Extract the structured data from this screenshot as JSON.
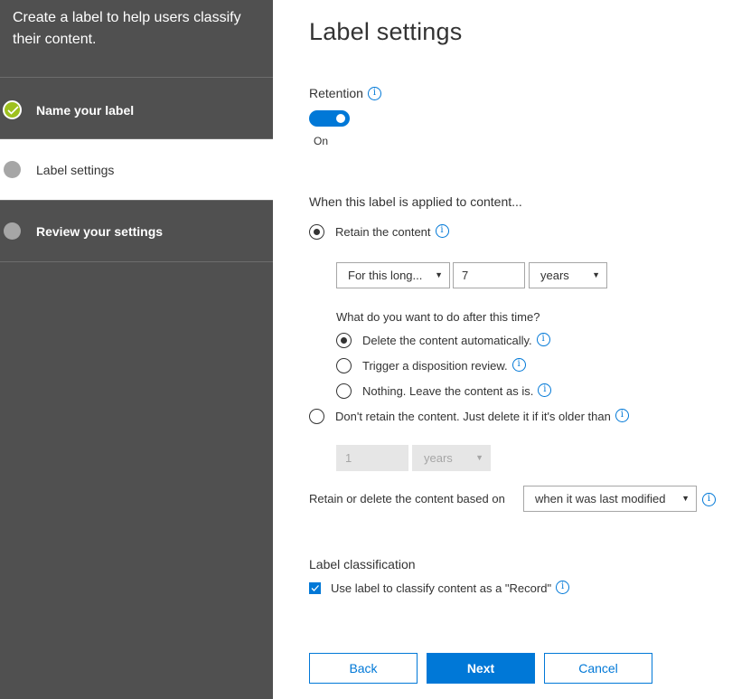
{
  "sidebar": {
    "intro": "Create a label to help users classify their content.",
    "steps": [
      {
        "label": "Name your label",
        "status": "completed"
      },
      {
        "label": "Label settings",
        "status": "current"
      },
      {
        "label": "Review your settings",
        "status": "pending"
      }
    ]
  },
  "main": {
    "title": "Label settings",
    "retention": {
      "title": "Retention",
      "info_icon": "i",
      "toggle_on": true,
      "toggle_state_label": "On"
    },
    "applied": {
      "title": "When this label is applied to content...",
      "retain_option": {
        "label": "Retain the content",
        "checked": true
      },
      "duration_select": "For this long...",
      "duration_value": "7",
      "duration_unit": "years",
      "after_question": "What do you want to do after this time?",
      "after_options": [
        {
          "label": "Delete the content automatically.",
          "checked": true
        },
        {
          "label": "Trigger a disposition review.",
          "checked": false
        },
        {
          "label": "Nothing. Leave the content as is.",
          "checked": false
        }
      ],
      "delete_option": {
        "label": "Don't retain the content. Just delete it if it's older than",
        "checked": false
      },
      "delete_value": "1",
      "delete_unit": "years",
      "basis_label": "Retain or delete the content based on",
      "basis_select": "when it was last modified"
    },
    "classification": {
      "title": "Label classification",
      "checkbox_label": "Use label to classify content as a \"Record\"",
      "checked": true
    },
    "buttons": {
      "back": "Back",
      "next": "Next",
      "cancel": "Cancel"
    }
  },
  "colors": {
    "accent": "#0078d7",
    "sidebar_bg": "#505050",
    "completed_step": "#9ec11f",
    "pending_step": "#a6a6a6"
  },
  "icons": {
    "info": "info-circle-icon",
    "caret": "caret-down-icon",
    "check": "checkmark-icon"
  }
}
